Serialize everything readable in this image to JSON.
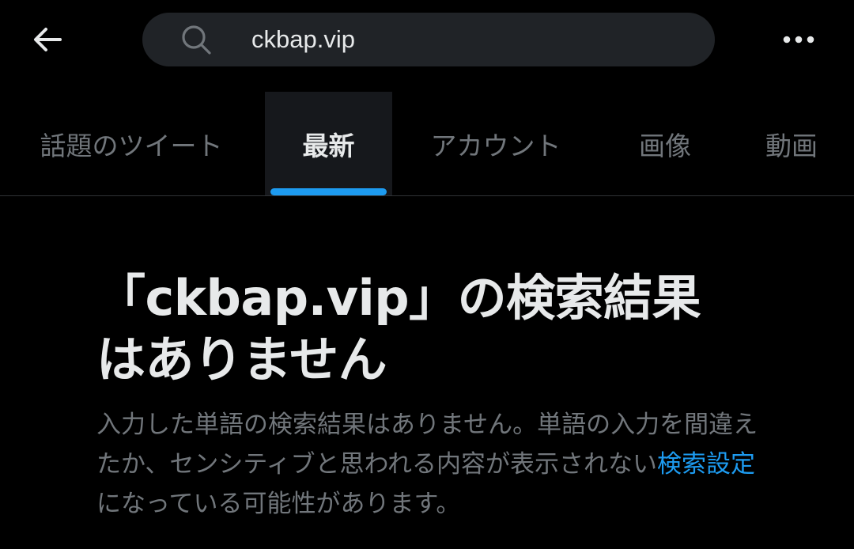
{
  "header": {
    "back_icon": "arrow-left-icon",
    "search": {
      "icon": "search-icon",
      "value": "ckbap.vip"
    },
    "more_icon": "more-horizontal-icon"
  },
  "tabs": [
    {
      "label": "話題のツイート",
      "active": false
    },
    {
      "label": "最新",
      "active": true
    },
    {
      "label": "アカウント",
      "active": false
    },
    {
      "label": "画像",
      "active": false
    },
    {
      "label": "動画",
      "active": false
    }
  ],
  "empty_state": {
    "title_line1": "「ckbap.vip」の検索結果",
    "title_line2": "はありません",
    "description_before": "入力した単語の検索結果はありません。単語の入力を間違えたか、センシティブと思われる内容が表示されない",
    "link_text": "検索設定",
    "description_after": "になっている可能性があります。"
  },
  "colors": {
    "background": "#000000",
    "text_primary": "#e7e9ea",
    "text_secondary": "#71767b",
    "accent": "#1d9bf0",
    "search_bg": "#202327"
  }
}
